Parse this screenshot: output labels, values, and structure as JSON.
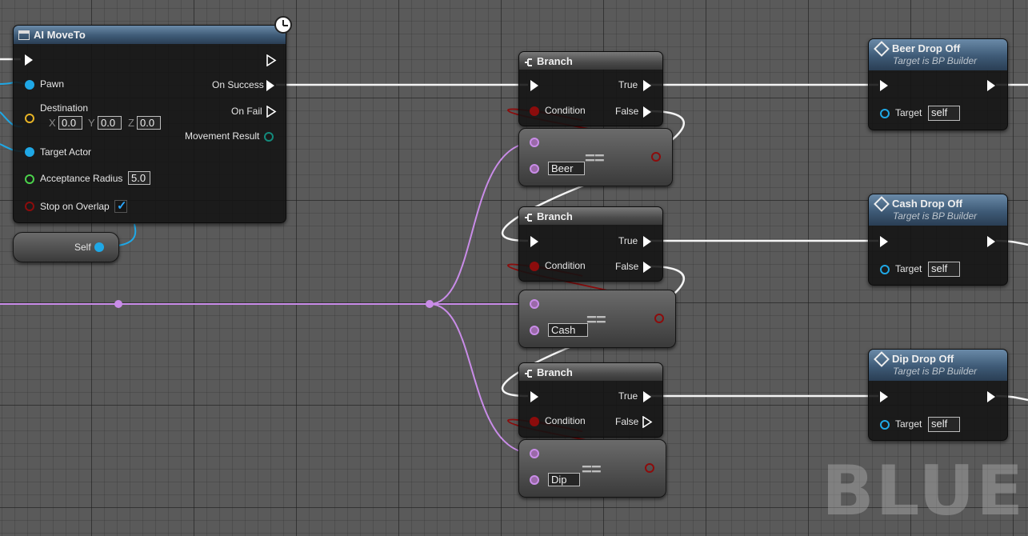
{
  "ai_move_to": {
    "title": "AI MoveTo",
    "pins": {
      "pawn": "Pawn",
      "destination": "Destination",
      "x_label": "X",
      "x_value": "0.0",
      "y_label": "Y",
      "y_value": "0.0",
      "z_label": "Z",
      "z_value": "0.0",
      "target_actor": "Target Actor",
      "acceptance_radius": "Acceptance Radius",
      "acceptance_radius_value": "5.0",
      "stop_on_overlap": "Stop on Overlap",
      "on_success": "On Success",
      "on_fail": "On Fail",
      "movement_result": "Movement Result"
    }
  },
  "self_node": {
    "label": "Self"
  },
  "branches": [
    {
      "title": "Branch",
      "true": "True",
      "false": "False",
      "condition": "Condition"
    },
    {
      "title": "Branch",
      "true": "True",
      "false": "False",
      "condition": "Condition"
    },
    {
      "title": "Branch",
      "true": "True",
      "false": "False",
      "condition": "Condition"
    }
  ],
  "equals_nodes": [
    {
      "operator": "==",
      "value": "Beer"
    },
    {
      "operator": "==",
      "value": "Cash"
    },
    {
      "operator": "==",
      "value": "Dip"
    }
  ],
  "functions": [
    {
      "title": "Beer Drop Off",
      "subtitle": "Target is BP Builder",
      "target_label": "Target",
      "target_value": "self"
    },
    {
      "title": "Cash Drop Off",
      "subtitle": "Target is BP Builder",
      "target_label": "Target",
      "target_value": "self"
    },
    {
      "title": "Dip Drop Off",
      "subtitle": "Target is BP Builder",
      "target_label": "Target",
      "target_value": "self"
    }
  ],
  "watermark": "BLUE",
  "colors": {
    "exec": "#ffffff",
    "object_pin": "#1fa8e6",
    "vector_pin": "#e6b325",
    "float_pin": "#4bd14b",
    "bool_pin": "#8c0c0c",
    "enum_pin": "#c98ce8",
    "struct_pin": "#138a7c"
  }
}
